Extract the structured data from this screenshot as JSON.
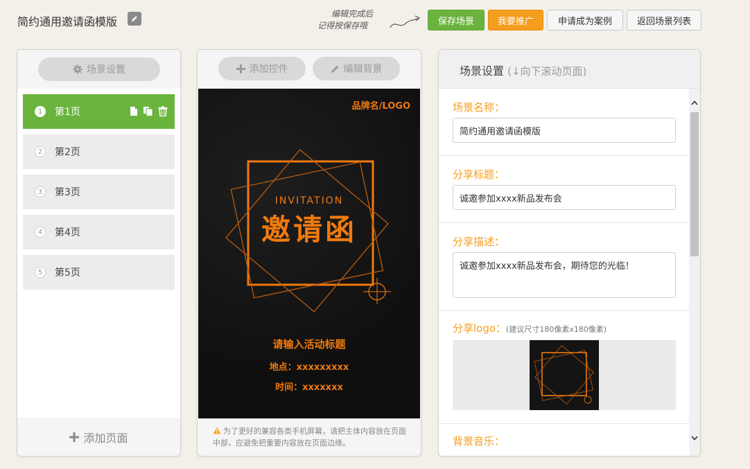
{
  "header": {
    "title": "简约通用邀请函模版",
    "hint_line1": "编辑完成后",
    "hint_line2": "记得按保存哦",
    "save_label": "保存场景",
    "promote_label": "我要推广",
    "apply_case_label": "申请成为案例",
    "back_label": "返回场景列表"
  },
  "pages_panel": {
    "settings_label": "场景设置",
    "pages": [
      {
        "num": "1",
        "label": "第1页",
        "active": true
      },
      {
        "num": "2",
        "label": "第2页",
        "active": false
      },
      {
        "num": "3",
        "label": "第3页",
        "active": false
      },
      {
        "num": "4",
        "label": "第4页",
        "active": false
      },
      {
        "num": "5",
        "label": "第5页",
        "active": false
      }
    ],
    "add_page_label": "添加页面"
  },
  "editor_panel": {
    "add_control_label": "添加控件",
    "edit_bg_label": "编辑背景",
    "preview": {
      "brand": "品牌名/LOGO",
      "invitation_en": "INVITATION",
      "invitation_cn": "邀请函",
      "event_title": "请输入活动标题",
      "location": "地点：xxxxxxxxx",
      "time": "时间：xxxxxxx"
    },
    "footer_note": "为了更好的兼容各类手机屏幕，请把主体内容放在页面中部，应避免把重要内容放在页面边缘。"
  },
  "settings_panel": {
    "title": "场景设置",
    "subtitle": "(↓向下滚动页面)",
    "scene_name_label": "场景名称：",
    "scene_name_value": "简约通用邀请函模版",
    "share_title_label": "分享标题：",
    "share_title_value": "诚邀参加xxxx新品发布会",
    "share_desc_label": "分享描述：",
    "share_desc_value": "诚邀参加xxxx新品发布会，期待您的光临！",
    "share_logo_label": "分享logo：",
    "share_logo_note": "(建议尺寸180像素x180像素)",
    "bg_music_label": "背景音乐："
  },
  "colors": {
    "green": "#6ab43e",
    "orange_button": "#f59d1d",
    "orange_accent": "#f07a0e",
    "background": "#f3f0e9"
  },
  "icons": [
    "pencil-icon",
    "arrow-icon",
    "gear-icon",
    "plus-icon",
    "page-icon",
    "copy-icon",
    "trash-icon",
    "warning-icon",
    "scroll-up-icon",
    "scroll-down-icon"
  ]
}
